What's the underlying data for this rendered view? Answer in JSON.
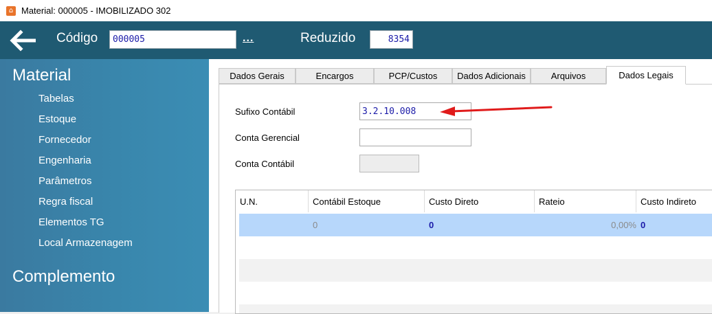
{
  "window": {
    "title": "Material: 000005 - IMOBILIZADO 302",
    "icon": "app-logo-icon"
  },
  "header": {
    "back_icon": "arrow-left-icon",
    "codigo_label": "Código",
    "codigo_value": "000005",
    "lookup_label": "...",
    "reduzido_label": "Reduzido",
    "reduzido_value": "8354"
  },
  "sidebar": {
    "sections": [
      {
        "title": "Material",
        "items": [
          "Tabelas",
          "Estoque",
          "Fornecedor",
          "Engenharia",
          "Parâmetros",
          "Regra fiscal",
          "Elementos TG",
          "Local Armazenagem"
        ]
      },
      {
        "title": "Complemento",
        "items": []
      }
    ]
  },
  "tabs": [
    "Dados Gerais",
    "Encargos",
    "PCP/Custos",
    "Dados Adicionais",
    "Arquivos",
    "Dados Legais"
  ],
  "active_tab": "Dados Legais",
  "form": {
    "sufixo_label": "Sufixo Contábil",
    "sufixo_value": "3.2.10.008",
    "conta_gerencial_label": "Conta Gerencial",
    "conta_gerencial_value": "",
    "conta_contabil_label": "Conta Contábil",
    "conta_contabil_value": ""
  },
  "grid": {
    "columns": [
      "U.N.",
      "Contábil Estoque",
      "Custo Direto",
      "Rateio",
      "Custo Indireto"
    ],
    "rows": [
      [
        "",
        "0",
        "0",
        "0,00%",
        "0"
      ]
    ]
  },
  "colors": {
    "header_bg": "#1f5a72",
    "sidebar_bg": "#3987ad",
    "selection": "#b7d7fb",
    "value_text": "#1a1aa8",
    "annotation_arrow": "#e01b1b"
  }
}
